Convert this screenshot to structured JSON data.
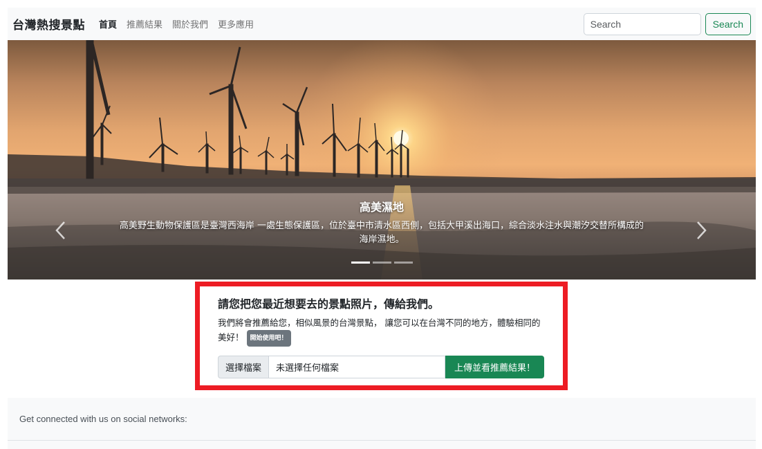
{
  "navbar": {
    "brand": "台灣熱搜景點",
    "links": [
      "首頁",
      "推薦結果",
      "關於我們",
      "更多應用"
    ],
    "search_placeholder": "Search",
    "search_button": "Search"
  },
  "carousel": {
    "title": "高美濕地",
    "text": "高美野生動物保護區是臺灣西海岸 一處生態保護區，位於臺中市清水區西側，包括大甲溪出海口，綜合淡水注水與潮汐交替所構成的海岸濕地。",
    "slide_count": 3,
    "active_slide": 1
  },
  "upload": {
    "title": "請您把您最近想要去的景點照片，傳給我們。",
    "description": "我們將會推薦給您，相似風景的台灣景點， 讓您可以在台灣不同的地方，體驗相同的美好！",
    "badge": "開始使用吧！",
    "file_button": "選擇檔案",
    "file_status": "未選擇任何檔案",
    "submit_button": "上傳並看推薦結果！"
  },
  "footer": {
    "social_text": "Get connected with us on social networks:"
  },
  "colors": {
    "accent_green": "#198754",
    "highlight_red": "#ed1c24",
    "badge_gray": "#6c757d"
  }
}
